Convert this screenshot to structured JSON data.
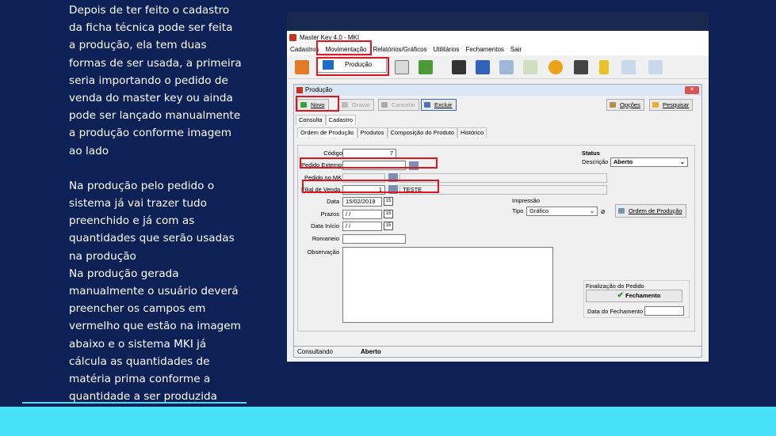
{
  "left_text": {
    "para1": "Depois de ter feito o cadastro\nda ficha técnica pode ser feita\na produção, ela tem duas\nformas de ser usada, a primeira\nseria importando o pedido de\nvenda do master key ou ainda\npode ser lançado manualmente\na produção conforme  imagem\nao lado",
    "para2": "Na produção pelo pedido o\nsistema já vai trazer tudo\npreenchido e já com as\nquantidades que serão usadas\nna produção\nNa produção gerada\nmanualmente o usuário deverá\npreencher os campos em\nvermelho que estão na imagem\nabaixo e o sistema MKI já\ncálcula as quantidades de\nmatéria prima conforme a\nquantidade a ser produzida"
  },
  "colors": {
    "background": "#0d2157",
    "accent": "#48e3fb",
    "highlight": "#e0141e"
  },
  "app": {
    "title": "Master Key 4.0 - MKI",
    "menu": [
      "Cadastros",
      "Movimentação",
      "Relatórios/Gráficos",
      "Utilitários",
      "Fechamentos",
      "Sair"
    ],
    "popup_item": "Produção"
  },
  "form": {
    "title": "Produção",
    "buttons": {
      "novo": "Novo",
      "gravar": "Gravar",
      "cancelar": "Cancelar",
      "excluir": "Excluir",
      "opcoes": "Opções",
      "pesquisar": "Pesquisar"
    },
    "outer_tabs": [
      "Consulta",
      "Cadastro"
    ],
    "inner_tabs": [
      "Ordem de Produção",
      "Produtos",
      "Composição do Produto",
      "Histórico"
    ],
    "fields": {
      "codigo_label": "Código",
      "codigo_value": "7",
      "pedido_externo_label": "Pedido Externo",
      "pedido_mk_label": "Pedido no MK",
      "filial_label": "Filial de Venda",
      "filial_value": "1",
      "filial_name": "TESTE",
      "data_label": "Data",
      "data_value": "15/02/2019",
      "prazos_label": "Prazos",
      "prazos_value": " / /",
      "data_inicio_label": "Data Início",
      "data_inicio_value": " / /",
      "romaneio_label": "Romaneio",
      "observacao_label": "Observação"
    },
    "status": {
      "heading": "Status",
      "descricao_label": "Descrição",
      "descricao_value": "Aberto"
    },
    "impressao": {
      "heading": "Impressão",
      "tipo_label": "Tipo",
      "tipo_value": "Gráfico",
      "ordem_button": "Ordem de Produção"
    },
    "finalizacao": {
      "heading": "Finalização do Pedido",
      "fechamento_button": "Fechamento",
      "data_fechamento_label": "Data do Fechamento"
    },
    "statusbar": {
      "left": "Consultando",
      "right": "Aberto"
    }
  }
}
